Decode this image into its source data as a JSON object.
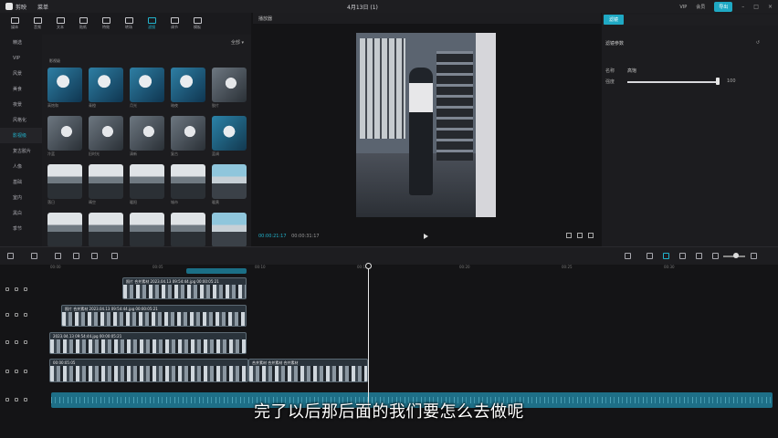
{
  "app": {
    "name": "剪映",
    "menu": "菜单",
    "project_title": "4月13日 (1)",
    "top_right": [
      "VIP",
      "会员",
      "导出"
    ],
    "export_label": "导出"
  },
  "tool_tabs": [
    {
      "label": "媒体",
      "icon": "media-icon",
      "active": false
    },
    {
      "label": "音频",
      "icon": "audio-icon",
      "active": false
    },
    {
      "label": "文本",
      "icon": "text-icon",
      "active": false
    },
    {
      "label": "贴纸",
      "icon": "sticker-icon",
      "active": false
    },
    {
      "label": "特效",
      "icon": "effects-icon",
      "active": false
    },
    {
      "label": "转场",
      "icon": "transition-icon",
      "active": false
    },
    {
      "label": "滤镜",
      "icon": "filter-icon",
      "active": true
    },
    {
      "label": "调节",
      "icon": "adjust-icon",
      "active": false
    },
    {
      "label": "模板",
      "icon": "template-icon",
      "active": false
    }
  ],
  "left_nav": {
    "items": [
      {
        "label": "精选",
        "active": false
      },
      {
        "label": "VIP",
        "active": false
      },
      {
        "label": "风景",
        "active": false
      },
      {
        "label": "美食",
        "active": false
      },
      {
        "label": "夜景",
        "active": false
      },
      {
        "label": "风格化",
        "active": false
      },
      {
        "label": "影视级",
        "active": true
      },
      {
        "label": "复古胶片",
        "active": false
      },
      {
        "label": "人像",
        "active": false
      },
      {
        "label": "基础",
        "active": false
      },
      {
        "label": "室内",
        "active": false
      },
      {
        "label": "黑白",
        "active": false
      },
      {
        "label": "季节",
        "active": false
      }
    ]
  },
  "media": {
    "header_action": "全部 ▾",
    "section_label": "影视级",
    "thumbs": [
      {
        "caption": "高饱和",
        "style": "portrait-a"
      },
      {
        "caption": "青橙",
        "style": "portrait-a"
      },
      {
        "caption": "月光",
        "style": "portrait-a"
      },
      {
        "caption": "暗夜",
        "style": "portrait-a"
      },
      {
        "caption": "胶片",
        "style": "portrait-b"
      },
      {
        "caption": "冷蓝",
        "style": "portrait-b"
      },
      {
        "caption": "旧时光",
        "style": "portrait-b"
      },
      {
        "caption": "清新",
        "style": "portrait-b"
      },
      {
        "caption": "复古",
        "style": "portrait-b"
      },
      {
        "caption": "蓝调",
        "style": "portrait-c"
      },
      {
        "caption": "落日",
        "style": "landscape"
      },
      {
        "caption": "晴空",
        "style": "landscape"
      },
      {
        "caption": "暖阳",
        "style": "landscape"
      },
      {
        "caption": "城市",
        "style": "landscape"
      },
      {
        "caption": "暖黄",
        "style": "landscape-blue"
      },
      {
        "caption": "",
        "style": "landscape"
      },
      {
        "caption": "",
        "style": "landscape"
      },
      {
        "caption": "",
        "style": "landscape"
      },
      {
        "caption": "",
        "style": "landscape"
      },
      {
        "caption": "",
        "style": "landscape-blue"
      }
    ]
  },
  "player": {
    "title": "播放器",
    "time_current": "00:00:21:17",
    "time_total": "00:00:31:17"
  },
  "right_panel": {
    "tab": "滤镜",
    "section_title": "滤镜参数",
    "name_label": "名称",
    "name_value": "高饱",
    "strength_label": "强度",
    "strength_value": "100",
    "strength_fraction": 1.0
  },
  "timeline": {
    "ruler_labels": [
      "00:00",
      "00:05",
      "00:10",
      "00:15",
      "00:20",
      "00:25",
      "00:30"
    ],
    "clips": [
      {
        "label": "照片  合并素材  2023.04.13 09:54:44.jpg  00:00:05:21"
      },
      {
        "label": "照片  合并素材  2023.04.13 09:54:44.jpg  00:00:05:21"
      },
      {
        "label": "2023.04.13 09:54:44.jpg  00:00:05:21"
      },
      {
        "label": "00:00:05:05"
      },
      {
        "label": "合并素材  合并素材  合并素材"
      }
    ]
  },
  "subtitle": "完了以后那后面的我们要怎么去做呢"
}
